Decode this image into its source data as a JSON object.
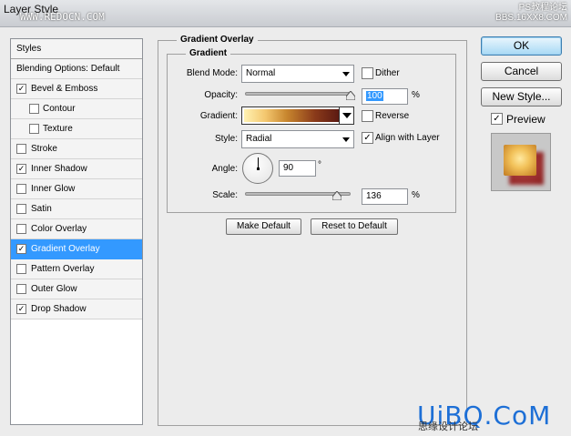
{
  "window": {
    "title": "Layer Style",
    "watermark_left": "WWW.REDOCN.COM",
    "watermark_right": "PS教程论坛\nBBS.16XX8.COM"
  },
  "styles_panel": {
    "header": "Styles",
    "blending_options": "Blending Options: Default",
    "items": [
      {
        "label": "Bevel & Emboss",
        "checked": true,
        "level": 1
      },
      {
        "label": "Contour",
        "checked": false,
        "level": 2
      },
      {
        "label": "Texture",
        "checked": false,
        "level": 2
      },
      {
        "label": "Stroke",
        "checked": false,
        "level": 1
      },
      {
        "label": "Inner Shadow",
        "checked": true,
        "level": 1
      },
      {
        "label": "Inner Glow",
        "checked": false,
        "level": 1
      },
      {
        "label": "Satin",
        "checked": false,
        "level": 1
      },
      {
        "label": "Color Overlay",
        "checked": false,
        "level": 1
      },
      {
        "label": "Gradient Overlay",
        "checked": true,
        "level": 1,
        "selected": true
      },
      {
        "label": "Pattern Overlay",
        "checked": false,
        "level": 1
      },
      {
        "label": "Outer Glow",
        "checked": false,
        "level": 1
      },
      {
        "label": "Drop Shadow",
        "checked": true,
        "level": 1
      }
    ]
  },
  "gradient_overlay": {
    "section_title": "Gradient Overlay",
    "group_title": "Gradient",
    "blend_mode_label": "Blend Mode:",
    "blend_mode_value": "Normal",
    "dither_label": "Dither",
    "dither_checked": false,
    "opacity_label": "Opacity:",
    "opacity_value": "100",
    "opacity_unit": "%",
    "opacity_level": 1.0,
    "gradient_label": "Gradient:",
    "reverse_label": "Reverse",
    "reverse_checked": false,
    "style_label": "Style:",
    "style_value": "Radial",
    "align_label": "Align with Layer",
    "align_checked": true,
    "angle_label": "Angle:",
    "angle_value": "90",
    "angle_unit": "°",
    "scale_label": "Scale:",
    "scale_value": "136",
    "scale_unit": "%",
    "make_default_label": "Make Default",
    "reset_default_label": "Reset to Default"
  },
  "side_buttons": {
    "ok": "OK",
    "cancel": "Cancel",
    "new_style": "New Style...",
    "preview_label": "Preview",
    "preview_checked": true
  },
  "logo": {
    "main": "UiBQ.CoM",
    "sub": "思缘设计论坛"
  },
  "colors": {
    "selection": "#3399ff",
    "gradient_start": "#fff2b2",
    "gradient_end": "#5c1a12"
  }
}
